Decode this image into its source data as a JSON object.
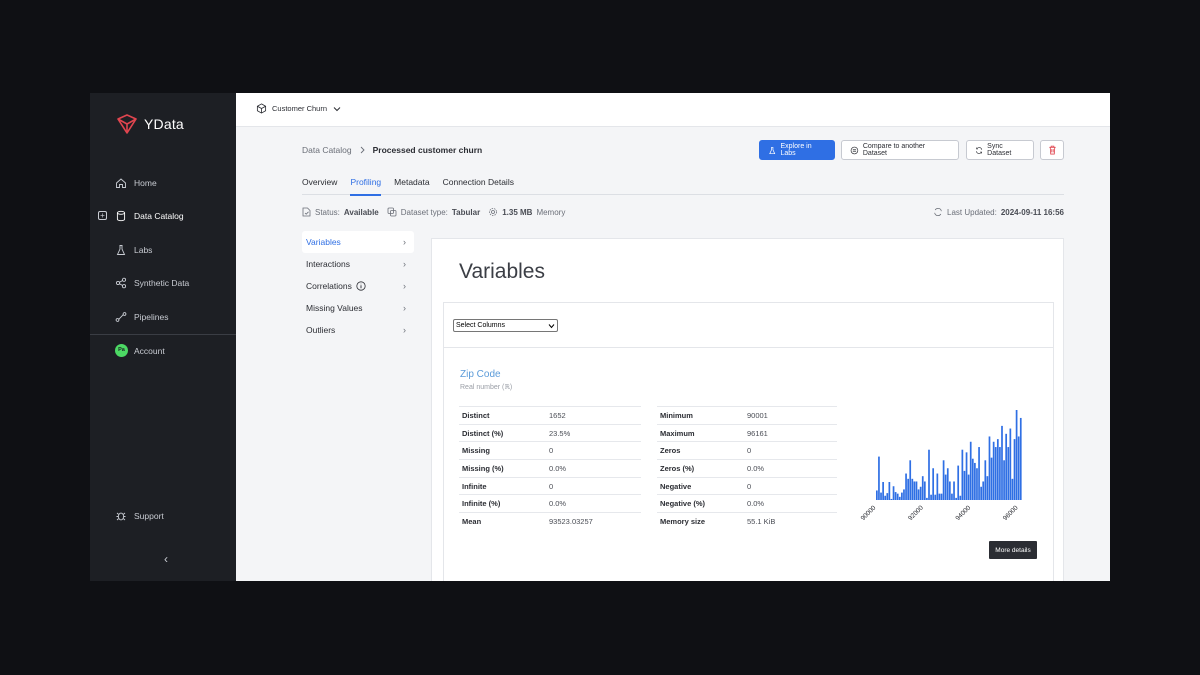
{
  "sidebar": {
    "logo_text": "YData",
    "items": [
      {
        "label": "Home"
      },
      {
        "label": "Data Catalog"
      },
      {
        "label": "Labs"
      },
      {
        "label": "Synthetic Data"
      },
      {
        "label": "Pipelines"
      },
      {
        "label": "Account"
      }
    ],
    "account_initials": "Pa",
    "support_label": "Support",
    "collapse_glyph": "‹"
  },
  "topbar": {
    "dataset_name": "Customer Churn"
  },
  "breadcrumb": {
    "root": "Data Catalog",
    "current": "Processed customer churn"
  },
  "actions": {
    "explore": "Explore in Labs",
    "compare": "Compare to another Dataset",
    "sync": "Sync Dataset"
  },
  "tabs": [
    {
      "label": "Overview"
    },
    {
      "label": "Profiling"
    },
    {
      "label": "Metadata"
    },
    {
      "label": "Connection Details"
    }
  ],
  "status": {
    "status_label": "Status:",
    "status_value": "Available",
    "type_label": "Dataset type:",
    "type_value": "Tabular",
    "memory_value": "1.35 MB",
    "memory_label": "Memory",
    "updated_label": "Last Updated:",
    "updated_value": "2024-09-11 16:56"
  },
  "submenu": [
    {
      "label": "Variables"
    },
    {
      "label": "Interactions"
    },
    {
      "label": "Correlations"
    },
    {
      "label": "Missing Values"
    },
    {
      "label": "Outliers"
    }
  ],
  "content": {
    "title": "Variables",
    "select_value": "Select Columns",
    "variable": {
      "name": "Zip Code",
      "type": "Real number (ℝ)",
      "stats_left": [
        {
          "k": "Distinct",
          "v": "1652"
        },
        {
          "k": "Distinct (%)",
          "v": "23.5%"
        },
        {
          "k": "Missing",
          "v": "0"
        },
        {
          "k": "Missing (%)",
          "v": "0.0%"
        },
        {
          "k": "Infinite",
          "v": "0"
        },
        {
          "k": "Infinite (%)",
          "v": "0.0%"
        },
        {
          "k": "Mean",
          "v": "93523.03257"
        }
      ],
      "stats_right": [
        {
          "k": "Minimum",
          "v": "90001"
        },
        {
          "k": "Maximum",
          "v": "96161"
        },
        {
          "k": "Zeros",
          "v": "0"
        },
        {
          "k": "Zeros (%)",
          "v": "0.0%"
        },
        {
          "k": "Negative",
          "v": "0"
        },
        {
          "k": "Negative (%)",
          "v": "0.0%"
        },
        {
          "k": "Memory size",
          "v": "55.1 KiB"
        }
      ],
      "more_details": "More details"
    }
  },
  "colors": {
    "accent": "#2f6fe4",
    "bar": "#2f6fe4",
    "danger": "#e0454f",
    "account": "#4cd964"
  },
  "chart_data": {
    "type": "bar",
    "x_tick_labels": [
      "90000",
      "92000",
      "94000",
      "96000"
    ],
    "x_tick_values": [
      90000,
      92000,
      94000,
      96000
    ],
    "xlim": [
      90001,
      96161
    ],
    "values": [
      18,
      82,
      14,
      34,
      8,
      13,
      34,
      2,
      26,
      15,
      12,
      6,
      14,
      20,
      50,
      40,
      75,
      40,
      35,
      35,
      20,
      25,
      45,
      35,
      4,
      95,
      10,
      60,
      10,
      50,
      12,
      12,
      75,
      48,
      60,
      35,
      12,
      35,
      4,
      65,
      8,
      95,
      55,
      90,
      48,
      110,
      78,
      70,
      60,
      100,
      25,
      35,
      75,
      45,
      120,
      80,
      110,
      100,
      115,
      100,
      140,
      75,
      125,
      100,
      135,
      40,
      115,
      170,
      120,
      155
    ]
  }
}
